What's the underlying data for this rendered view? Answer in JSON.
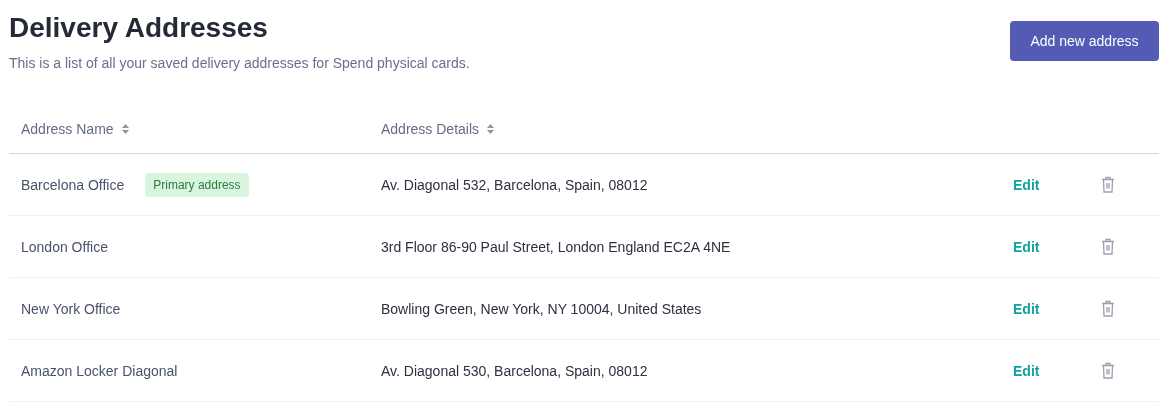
{
  "header": {
    "title": "Delivery Addresses",
    "subtitle": "This is a list of all your saved delivery addresses for Spend physical cards.",
    "action": "Add new address"
  },
  "table": {
    "columns": [
      {
        "label": "Address Name",
        "sortable": true
      },
      {
        "label": "Address Details",
        "sortable": true
      }
    ],
    "rows": [
      {
        "name": "Barcelona Office",
        "badge": "Primary address",
        "details": "Av. Diagonal 532, Barcelona, Spain, 08012",
        "edit": "Edit"
      },
      {
        "name": "London Office",
        "details": "3rd Floor 86-90 Paul Street, London England EC2A 4NE",
        "edit": "Edit"
      },
      {
        "name": "New York Office",
        "details": "Bowling Green, New York, NY 10004, United States",
        "edit": "Edit"
      },
      {
        "name": "Amazon Locker Diagonal",
        "details": "Av. Diagonal 530, Barcelona, Spain, 08012",
        "edit": "Edit"
      }
    ]
  }
}
